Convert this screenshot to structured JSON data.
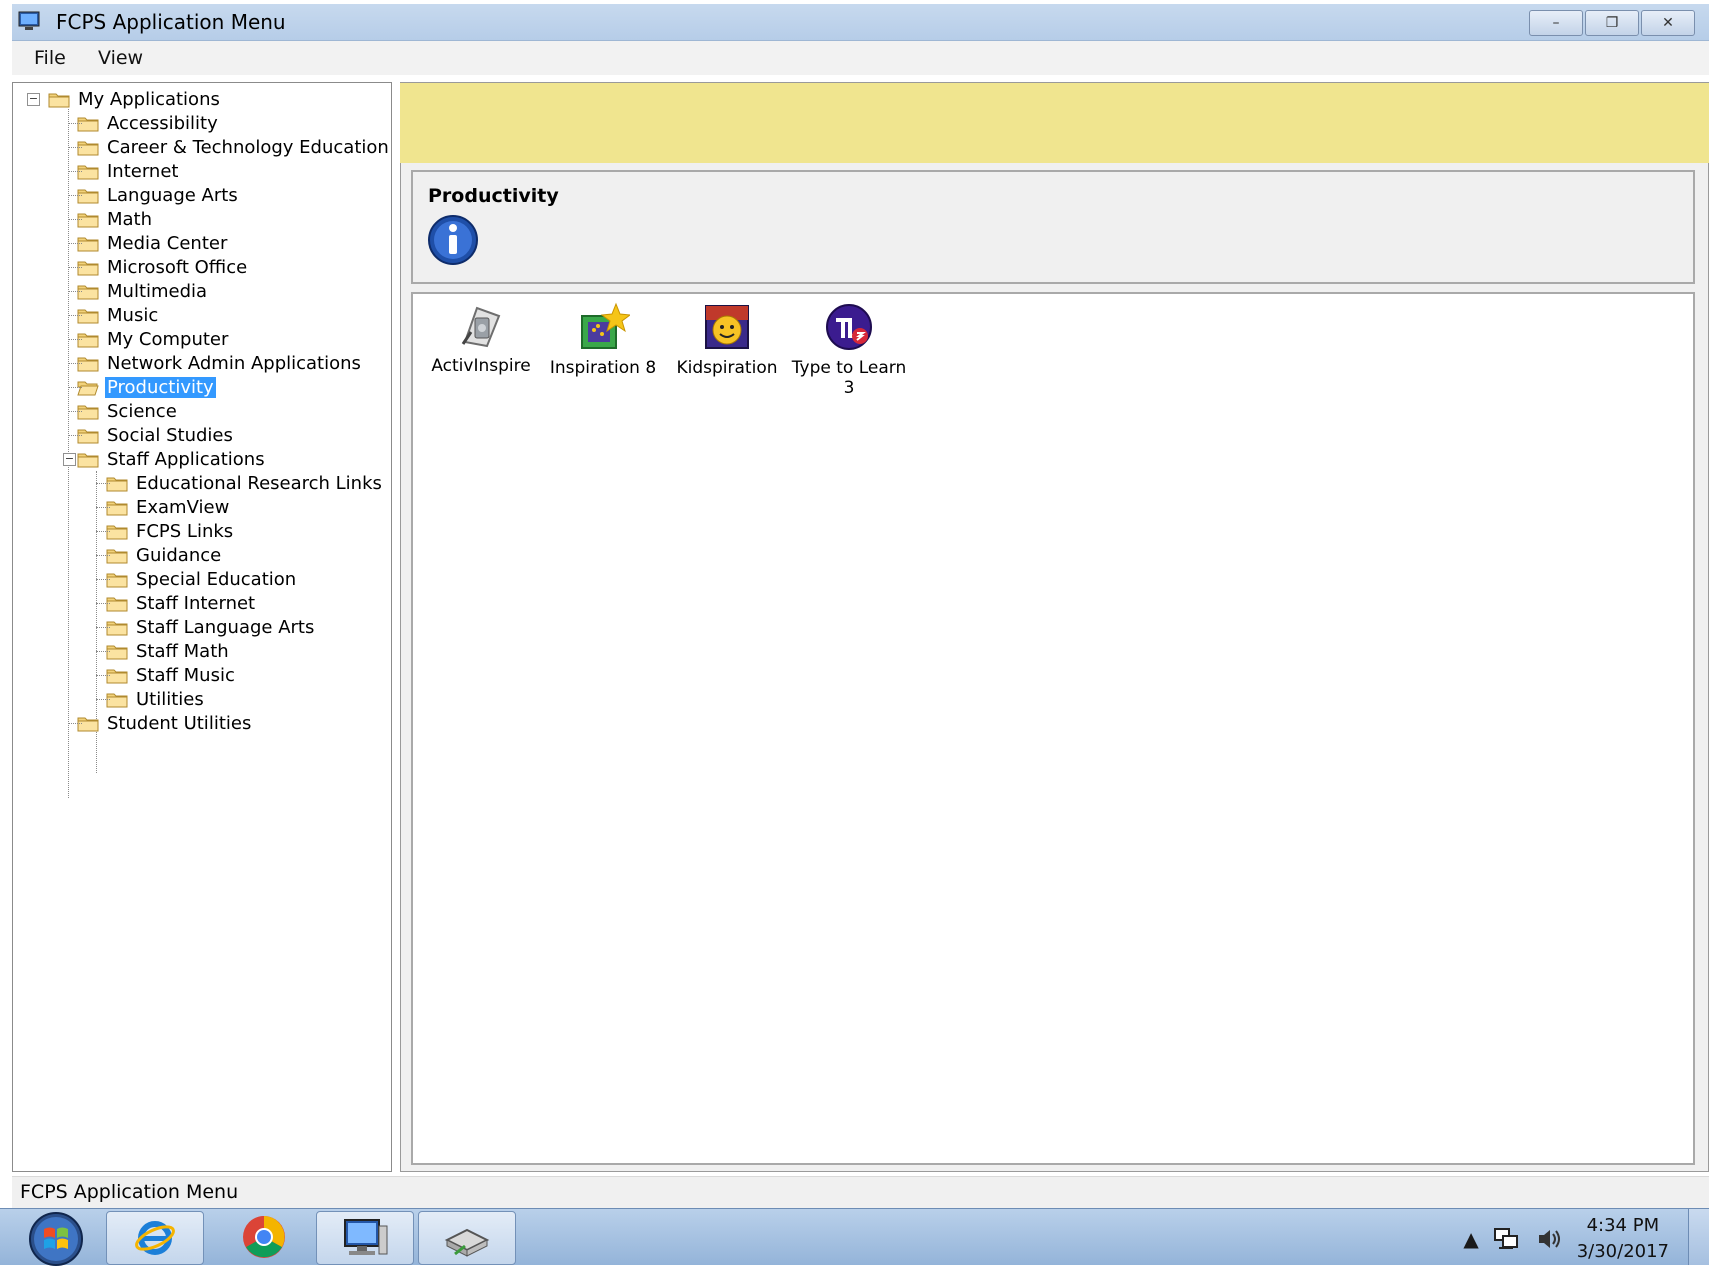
{
  "window": {
    "title": "FCPS Application Menu",
    "controls": {
      "minimize": "–",
      "restore": "❐",
      "close": "✕"
    }
  },
  "menu": {
    "file": "File",
    "view": "View"
  },
  "tree": {
    "root": "My Applications",
    "items": [
      "Accessibility",
      "Career & Technology Education",
      "Internet",
      "Language Arts",
      "Math",
      "Media Center",
      "Microsoft Office",
      "Multimedia",
      "Music",
      "My Computer",
      "Network Admin Applications",
      "Productivity",
      "Science",
      "Social Studies",
      "Staff Applications",
      "Student Utilities"
    ],
    "staff_children": [
      "Educational Research Links",
      "ExamView",
      "FCPS Links",
      "Guidance",
      "Special Education",
      "Staff Internet",
      "Staff Language Arts",
      "Staff Math",
      "Staff Music",
      "Utilities"
    ],
    "selected": "Productivity"
  },
  "category": {
    "title": "Productivity"
  },
  "apps": [
    {
      "label": "ActivInspire"
    },
    {
      "label": "Inspiration 8"
    },
    {
      "label": "Kidspiration"
    },
    {
      "label": "Type to Learn 3"
    }
  ],
  "status": {
    "text": "FCPS Application Menu"
  },
  "taskbar": {
    "clock_time": "4:34 PM",
    "clock_date": "3/30/2017",
    "tray_icons": [
      "show-hidden-icons",
      "network-icon",
      "volume-icon"
    ]
  },
  "colors": {
    "banner": "#f0e58f",
    "selection": "#3399ff",
    "titlebar": "#c7d9ee",
    "taskbar": "#a9c4e4"
  }
}
